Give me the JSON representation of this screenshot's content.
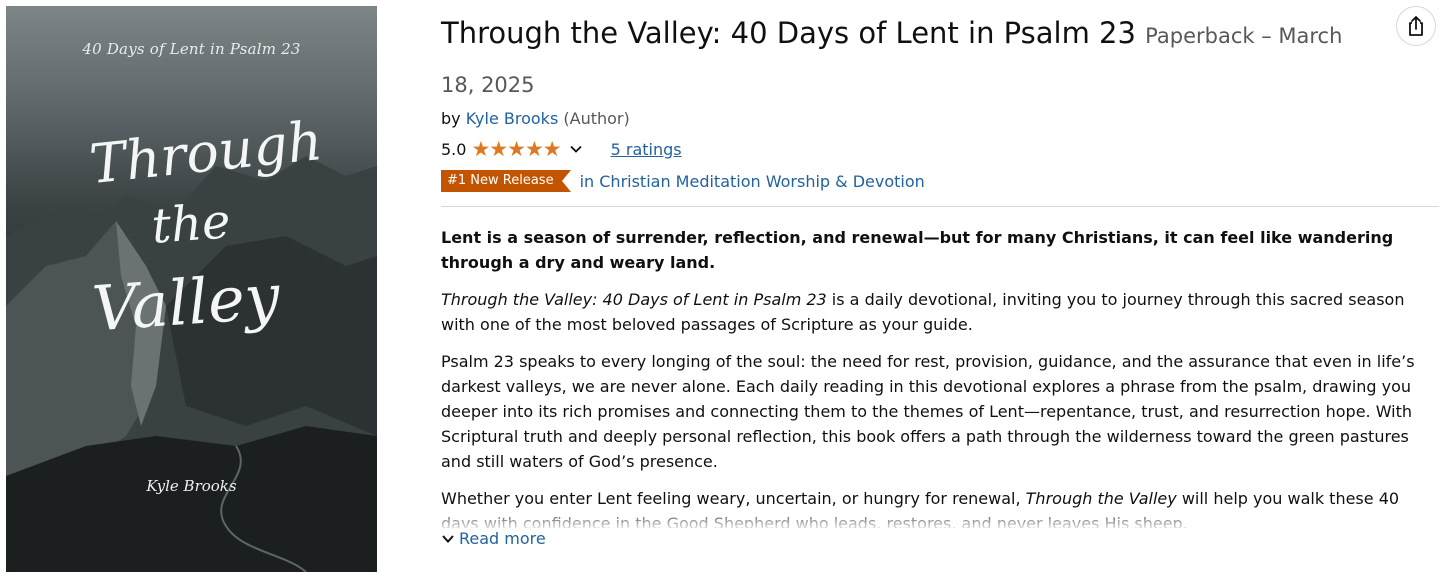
{
  "cover": {
    "subtitle": "40 Days of Lent in Psalm 23",
    "title_words": [
      "Through",
      "the",
      "Valley"
    ],
    "author": "Kyle Brooks"
  },
  "product": {
    "title": "Through the Valley: 40 Days of Lent in Psalm 23",
    "format": "Paperback – March 18, 2025",
    "by_prefix": "by",
    "author": "Kyle Brooks",
    "author_role": "(Author)",
    "rating_value": "5.0",
    "stars": 5,
    "ratings_count": "5 ratings",
    "badge": "#1 New Release",
    "category": "in Christian Meditation Worship & Devotion"
  },
  "description": {
    "lead": "Lent is a season of surrender, reflection, and renewal—but for many Christians, it can feel like wandering through a dry and weary land.",
    "p1_italic": "Through the Valley: 40 Days of Lent in Psalm 23",
    "p1_rest": " is a daily devotional, inviting you to journey through this sacred season with one of the most beloved passages of Scripture as your guide.",
    "p2": "Psalm 23 speaks to every longing of the soul: the need for rest, provision, guidance, and the assurance that even in life’s darkest valleys, we are never alone. Each daily reading in this devotional explores a phrase from the psalm, drawing you deeper into its rich promises and connecting them to the themes of Lent—repentance, trust, and resurrection hope. With Scriptural truth and deeply personal reflection, this book offers a path through the wilderness toward the green pastures and still waters of God’s presence.",
    "p3_start": "Whether you enter Lent feeling weary, uncertain, or hungry for renewal, ",
    "p3_italic": "Through the Valley",
    "p3_rest": " will help you walk these 40 days with confidence in the Good Shepherd who leads, restores, and never leaves His sheep.",
    "read_more": "Read more"
  },
  "colors": {
    "link": "#2162a1",
    "star": "#de7921",
    "badge_bg": "#c45500"
  },
  "icons": [
    "share-icon",
    "chevron-down-icon",
    "star-icon"
  ]
}
